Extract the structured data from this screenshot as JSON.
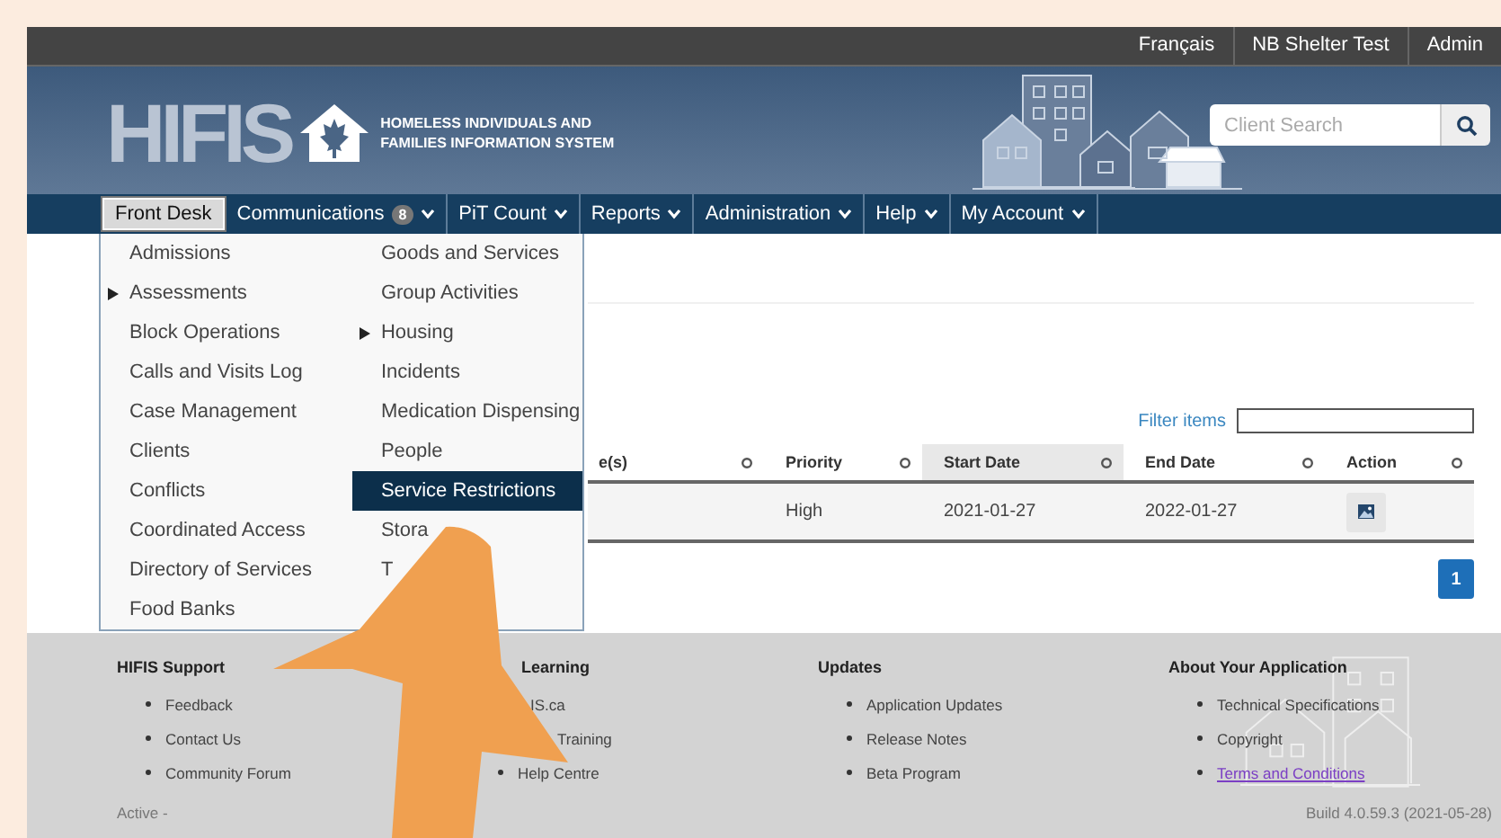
{
  "top_bar": {
    "links": [
      "Français",
      "NB Shelter Test",
      "Admin"
    ]
  },
  "header": {
    "logo_text": "HIFIS",
    "tagline": [
      "HOMELESS INDIVIDUALS AND",
      "FAMILIES INFORMATION SYSTEM"
    ],
    "search": {
      "placeholder": "Client Search"
    }
  },
  "nav": [
    {
      "label": "Front Desk",
      "selected": true,
      "dropdown": false
    },
    {
      "label": "Communications",
      "badge": "8",
      "selected": false,
      "dropdown": true
    },
    {
      "label": "PiT Count",
      "selected": false,
      "dropdown": true
    },
    {
      "label": "Reports",
      "selected": false,
      "dropdown": true
    },
    {
      "label": "Administration",
      "selected": false,
      "dropdown": true
    },
    {
      "label": "Help",
      "selected": false,
      "dropdown": true
    },
    {
      "label": "My Account",
      "selected": false,
      "dropdown": true
    }
  ],
  "front_desk_menu": {
    "columns": [
      [
        {
          "label": "Admissions",
          "submenu": false,
          "selected": false
        },
        {
          "label": "Assessments",
          "submenu": true,
          "selected": false
        },
        {
          "label": "Block Operations",
          "submenu": false,
          "selected": false
        },
        {
          "label": "Calls and Visits Log",
          "submenu": false,
          "selected": false
        },
        {
          "label": "Case Management",
          "submenu": false,
          "selected": false
        },
        {
          "label": "Clients",
          "submenu": false,
          "selected": false
        },
        {
          "label": "Conflicts",
          "submenu": false,
          "selected": false
        },
        {
          "label": "Coordinated Access",
          "submenu": false,
          "selected": false
        },
        {
          "label": "Directory of Services",
          "submenu": false,
          "selected": false
        },
        {
          "label": "Food Banks",
          "submenu": false,
          "selected": false
        }
      ],
      [
        {
          "label": "Goods and Services",
          "submenu": false,
          "selected": false
        },
        {
          "label": "Group Activities",
          "submenu": false,
          "selected": false
        },
        {
          "label": "Housing",
          "submenu": true,
          "selected": false
        },
        {
          "label": "Incidents",
          "submenu": false,
          "selected": false
        },
        {
          "label": "Medication Dispensing",
          "submenu": false,
          "selected": false
        },
        {
          "label": "People",
          "submenu": false,
          "selected": false
        },
        {
          "label": "Service Restrictions",
          "submenu": false,
          "selected": true
        },
        {
          "label": "Stora",
          "submenu": false,
          "selected": false
        },
        {
          "label": "T",
          "submenu": false,
          "selected": false
        }
      ]
    ]
  },
  "table": {
    "filter_label": "Filter items",
    "columns": [
      {
        "label": "e(s)",
        "highlighted": false
      },
      {
        "label": "Priority",
        "highlighted": false
      },
      {
        "label": "Start Date",
        "highlighted": true
      },
      {
        "label": "End Date",
        "highlighted": false
      },
      {
        "label": "Action",
        "highlighted": false
      }
    ],
    "rows": [
      {
        "cells": [
          "",
          "High",
          "2021-01-27",
          "2022-01-27"
        ],
        "action": true
      }
    ],
    "pages": [
      {
        "label": "1",
        "selected": true
      }
    ]
  },
  "footer": {
    "sections": [
      {
        "title": "HIFIS Support",
        "links": [
          {
            "label": "Feedback",
            "bullet": true,
            "visited": false
          },
          {
            "label": "Contact Us",
            "bullet": true,
            "visited": false
          },
          {
            "label": "Community Forum",
            "bullet": true,
            "visited": false
          }
        ]
      },
      {
        "title": "Learning",
        "links": [
          {
            "label": "IS.ca",
            "bullet": false,
            "visited": false
          },
          {
            "label": "Training",
            "bullet": false,
            "visited": false
          },
          {
            "label": "Help Centre",
            "bullet": true,
            "visited": false
          }
        ]
      },
      {
        "title": "Updates",
        "links": [
          {
            "label": "Application Updates",
            "bullet": true,
            "visited": false
          },
          {
            "label": "Release Notes",
            "bullet": true,
            "visited": false
          },
          {
            "label": "Beta Program",
            "bullet": true,
            "visited": false
          }
        ]
      },
      {
        "title": "About Your Application",
        "links": [
          {
            "label": "Technical Specifications",
            "bullet": true,
            "visited": false
          },
          {
            "label": "Copyright",
            "bullet": true,
            "visited": false
          },
          {
            "label": "Terms and Conditions",
            "bullet": true,
            "visited": true
          }
        ]
      }
    ],
    "status": "Active -",
    "build": "Build 4.0.59.3 (2021-05-28)"
  }
}
